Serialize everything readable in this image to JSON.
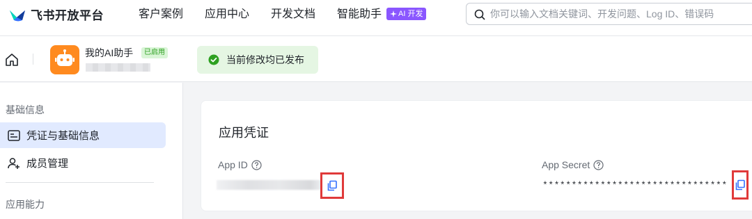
{
  "topnav": {
    "brand": "飞书开放平台",
    "items": [
      "客户案例",
      "应用中心",
      "开发文档",
      "智能助手"
    ],
    "ai_badge": "AI 开发",
    "search_placeholder": "你可以输入文档关键词、开发问题、Log ID、错误码"
  },
  "appbar": {
    "app_name": "我的AI助手",
    "status_tag": "已启用",
    "publish_notice": "当前修改均已发布"
  },
  "sidebar": {
    "group_basic": "基础信息",
    "items": [
      {
        "label": "凭证与基础信息",
        "icon": "credential-icon",
        "active": true
      },
      {
        "label": "成员管理",
        "icon": "member-icon",
        "active": false
      }
    ],
    "group_capability": "应用能力"
  },
  "credentials": {
    "title": "应用凭证",
    "app_id_label": "App ID",
    "app_secret_label": "App Secret",
    "app_secret_value": "********************************"
  },
  "colors": {
    "brand_blue": "#3370ff",
    "highlight_red": "#e03a3a",
    "success_green": "#2ea121",
    "ai_purple": "#8a56ff"
  }
}
